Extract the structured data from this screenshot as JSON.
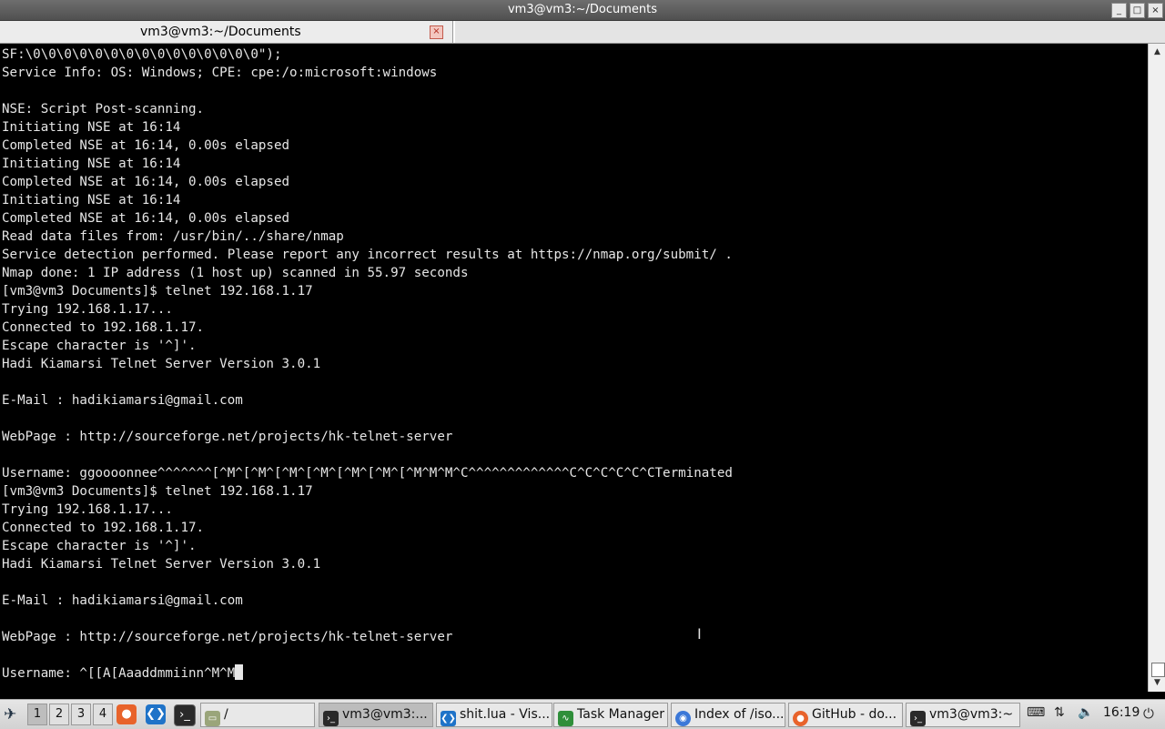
{
  "window": {
    "title": "vm3@vm3:~/Documents",
    "buttons": {
      "minimize": "_",
      "maximize": "□",
      "close": "×"
    }
  },
  "tabs": [
    {
      "label": "vm3@vm3:~/Documents",
      "close": "×"
    }
  ],
  "terminal": {
    "lines": [
      "SF:\\0\\0\\0\\0\\0\\0\\0\\0\\0\\0\\0\\0\\0\\0\\0\");",
      "Service Info: OS: Windows; CPE: cpe:/o:microsoft:windows",
      "",
      "NSE: Script Post-scanning.",
      "Initiating NSE at 16:14",
      "Completed NSE at 16:14, 0.00s elapsed",
      "Initiating NSE at 16:14",
      "Completed NSE at 16:14, 0.00s elapsed",
      "Initiating NSE at 16:14",
      "Completed NSE at 16:14, 0.00s elapsed",
      "Read data files from: /usr/bin/../share/nmap",
      "Service detection performed. Please report any incorrect results at https://nmap.org/submit/ .",
      "Nmap done: 1 IP address (1 host up) scanned in 55.97 seconds",
      "[vm3@vm3 Documents]$ telnet 192.168.1.17",
      "Trying 192.168.1.17...",
      "Connected to 192.168.1.17.",
      "Escape character is '^]'.",
      "Hadi Kiamarsi Telnet Server Version 3.0.1",
      "",
      "E-Mail : hadikiamarsi@gmail.com",
      "",
      "WebPage : http://sourceforge.net/projects/hk-telnet-server",
      "",
      "Username: ggoooonnee^^^^^^^[^M^[^M^[^M^[^M^[^M^[^M^[^M^M^M^C^^^^^^^^^^^^^C^C^C^C^C^CTerminated",
      "[vm3@vm3 Documents]$ telnet 192.168.1.17",
      "Trying 192.168.1.17...",
      "Connected to 192.168.1.17.",
      "Escape character is '^]'.",
      "Hadi Kiamarsi Telnet Server Version 3.0.1",
      "",
      "E-Mail : hadikiamarsi@gmail.com",
      "",
      "WebPage : http://sourceforge.net/projects/hk-telnet-server",
      "",
      "Username: ^[[A[Aaaddmmiinn^M^M"
    ],
    "colors": {
      "background": "#000000",
      "foreground": "#e6e6e6"
    }
  },
  "taskbar": {
    "workspaces": [
      "1",
      "2",
      "3",
      "4"
    ],
    "active_workspace": "1",
    "launchers": [
      {
        "icon": "firefox-icon"
      },
      {
        "icon": "vscode-icon"
      },
      {
        "icon": "terminal-icon"
      }
    ],
    "items": [
      {
        "label": "/",
        "icon": "folder-icon",
        "active": false
      },
      {
        "label": "vm3@vm3:...",
        "icon": "terminal-icon",
        "active": true
      },
      {
        "label": "shit.lua - Vis...",
        "icon": "vscode-icon",
        "active": false
      },
      {
        "label": "Task Manager",
        "icon": "task-manager-icon",
        "active": false
      },
      {
        "label": "Index of /iso...",
        "icon": "chrome-icon",
        "active": false
      },
      {
        "label": "GitHub - do...",
        "icon": "firefox-icon",
        "active": false
      },
      {
        "label": "vm3@vm3:~",
        "icon": "terminal-icon",
        "active": false
      }
    ],
    "tray": {
      "clock": "16:19"
    }
  }
}
